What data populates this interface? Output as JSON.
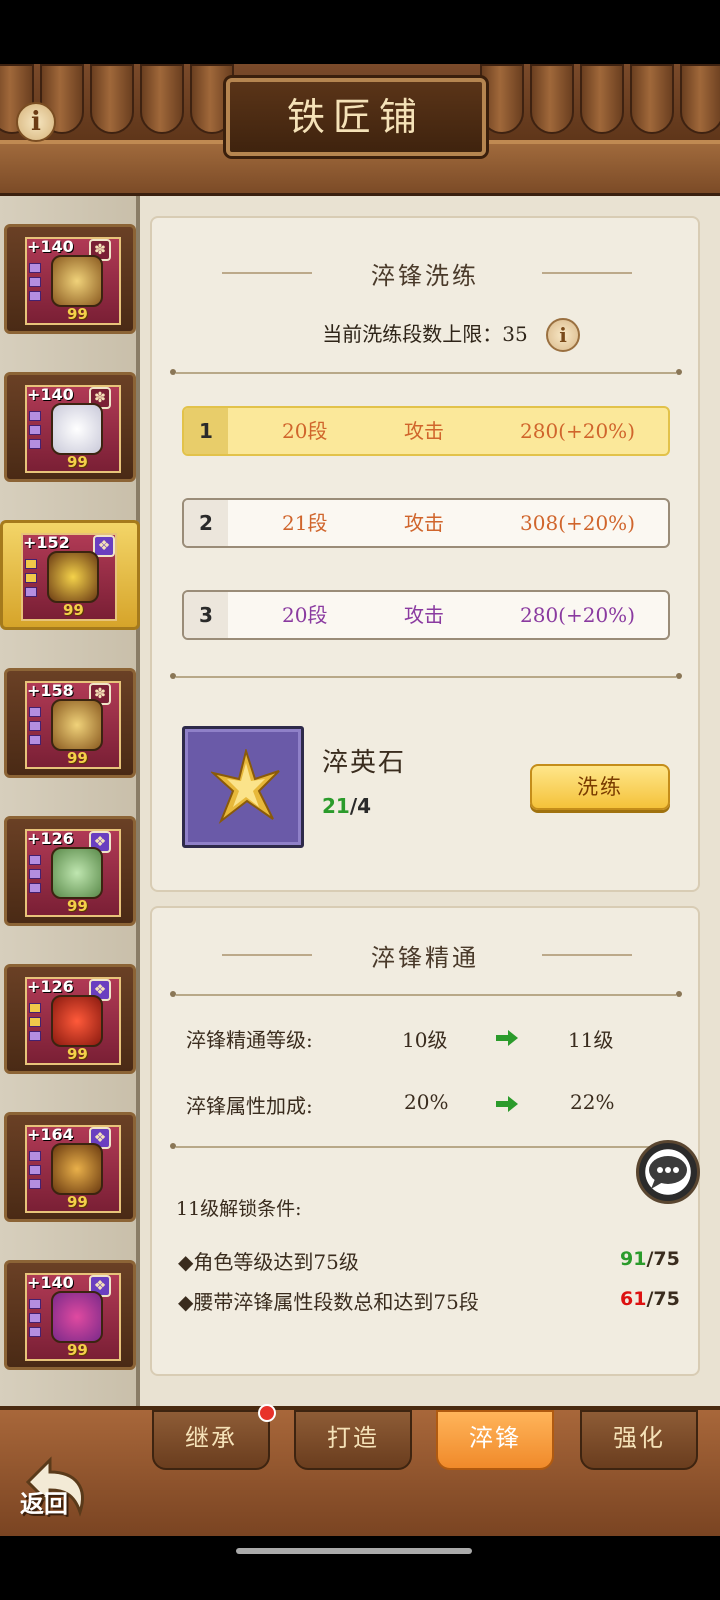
{
  "header": {
    "title": "铁匠铺",
    "info_label": "i"
  },
  "sidebar": {
    "items": [
      {
        "level": "+140",
        "stars": "99",
        "badge": "✽",
        "rarity": "red"
      },
      {
        "level": "+140",
        "stars": "99",
        "badge": "✽",
        "rarity": "red"
      },
      {
        "level": "+152",
        "stars": "99",
        "badge": "❖",
        "rarity": "purple",
        "selected": true
      },
      {
        "level": "+158",
        "stars": "99",
        "badge": "✽",
        "rarity": "red"
      },
      {
        "level": "+126",
        "stars": "99",
        "badge": "❖",
        "rarity": "purple"
      },
      {
        "level": "+126",
        "stars": "99",
        "badge": "❖",
        "rarity": "purple"
      },
      {
        "level": "+164",
        "stars": "99",
        "badge": "❖",
        "rarity": "purple"
      },
      {
        "level": "+140",
        "stars": "99",
        "badge": "❖",
        "rarity": "purple"
      }
    ]
  },
  "refine": {
    "title": "淬锋洗练",
    "limit_label": "当前洗练段数上限：35",
    "rows": [
      {
        "num": "1",
        "segments": "20段",
        "attribute": "攻击",
        "value": "280(+20%)",
        "highlighted": true,
        "color": "orange"
      },
      {
        "num": "2",
        "segments": "21段",
        "attribute": "攻击",
        "value": "308(+20%)",
        "highlighted": false,
        "color": "orange"
      },
      {
        "num": "3",
        "segments": "20段",
        "attribute": "攻击",
        "value": "280(+20%)",
        "highlighted": false,
        "color": "purple"
      }
    ],
    "material": {
      "name": "淬英石",
      "owned": "21",
      "required": "/4"
    },
    "button": "洗练"
  },
  "mastery": {
    "title": "淬锋精通",
    "rows": [
      {
        "label": "淬锋精通等级:",
        "current": "10级",
        "next": "11级"
      },
      {
        "label": "淬锋属性加成:",
        "current": "20%",
        "next": "22%"
      }
    ],
    "unlock_title": "11级解锁条件:",
    "conditions": [
      {
        "text": "◆角色等级达到75级",
        "current": "91",
        "required": "/75",
        "met": true
      },
      {
        "text": "◆腰带淬锋属性段数总和达到75段",
        "current": "61",
        "required": "/75",
        "met": false
      }
    ]
  },
  "tabs": [
    {
      "label": "继承",
      "notify": true
    },
    {
      "label": "打造"
    },
    {
      "label": "淬锋",
      "active": true
    },
    {
      "label": "强化"
    }
  ],
  "back_label": "返回",
  "colors": {
    "highlight_row": "#fbe89a",
    "green": "#2b9b2b",
    "red": "#dd1111",
    "orange": "#d0652c",
    "purple": "#8a3aa0"
  }
}
